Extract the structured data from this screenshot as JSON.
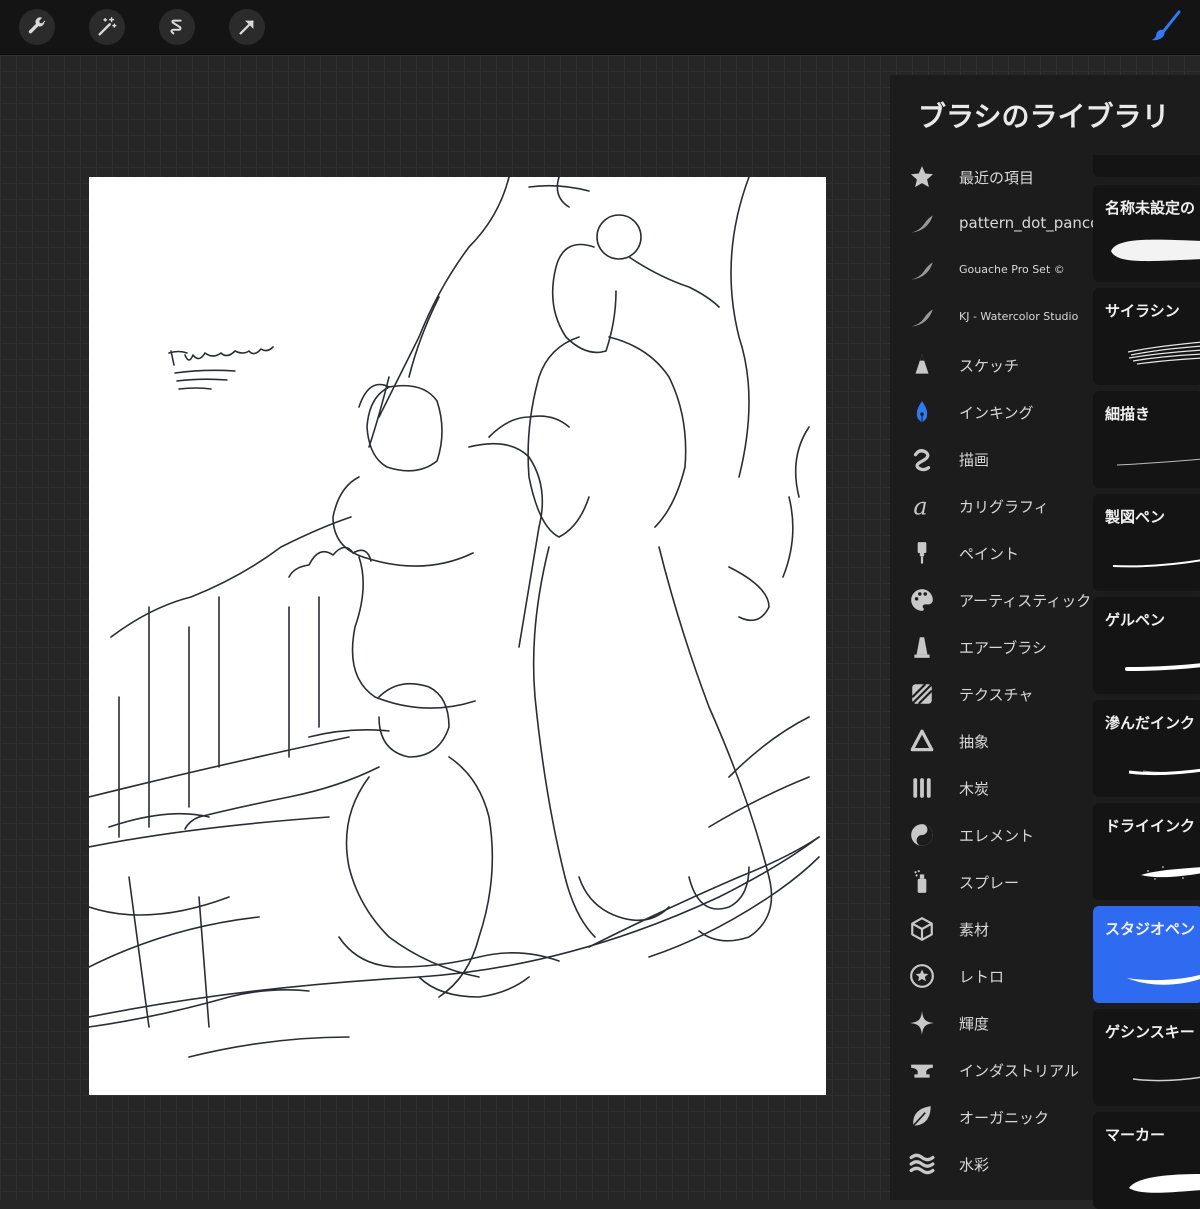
{
  "toolbar": {
    "tools": [
      "wrench-icon",
      "magic-wand-icon",
      "selection-icon",
      "move-arrow-icon"
    ],
    "active_tool": "brush-icon",
    "accent": "#2f7bf5"
  },
  "brush_library": {
    "title": "ブラシのライブラリ",
    "categories": [
      {
        "label": "最近の項目",
        "icon": "star-icon"
      },
      {
        "label": "pattern_dot_panco",
        "icon": "brush-stroke-icon"
      },
      {
        "label": "Gouache Pro Set ©",
        "icon": "brush-stroke-icon"
      },
      {
        "label": "KJ - Watercolor Studio",
        "icon": "brush-stroke-icon"
      },
      {
        "label": "スケッチ",
        "icon": "pencil-tip-icon"
      },
      {
        "label": "インキング",
        "icon": "pen-nib-icon"
      },
      {
        "label": "描画",
        "icon": "squiggle-icon"
      },
      {
        "label": "カリグラフィ",
        "icon": "calligraphy-icon"
      },
      {
        "label": "ペイント",
        "icon": "paint-brush-icon"
      },
      {
        "label": "アーティスティック",
        "icon": "palette-icon"
      },
      {
        "label": "エアーブラシ",
        "icon": "airbrush-icon"
      },
      {
        "label": "テクスチャ",
        "icon": "texture-icon"
      },
      {
        "label": "抽象",
        "icon": "triangle-icon"
      },
      {
        "label": "木炭",
        "icon": "charcoal-icon"
      },
      {
        "label": "エレメント",
        "icon": "yin-yang-icon"
      },
      {
        "label": "スプレー",
        "icon": "spray-can-icon"
      },
      {
        "label": "素材",
        "icon": "cube-icon"
      },
      {
        "label": "レトロ",
        "icon": "retro-star-icon"
      },
      {
        "label": "輝度",
        "icon": "sparkle-icon"
      },
      {
        "label": "インダストリアル",
        "icon": "anvil-icon"
      },
      {
        "label": "オーガニック",
        "icon": "leaf-icon"
      },
      {
        "label": "水彩",
        "icon": "waves-icon"
      }
    ],
    "brushes": [
      {
        "name": "名称未設定の",
        "selected": false
      },
      {
        "name": "サイラシン",
        "selected": false
      },
      {
        "name": "細描き",
        "selected": false
      },
      {
        "name": "製図ペン",
        "selected": false
      },
      {
        "name": "ゲルペン",
        "selected": false
      },
      {
        "name": "滲んだインク",
        "selected": false
      },
      {
        "name": "ドライインク",
        "selected": false
      },
      {
        "name": "スタジオペン",
        "selected": true
      },
      {
        "name": "ゲシンスキー",
        "selected": false
      },
      {
        "name": "マーカー",
        "selected": false
      }
    ]
  }
}
